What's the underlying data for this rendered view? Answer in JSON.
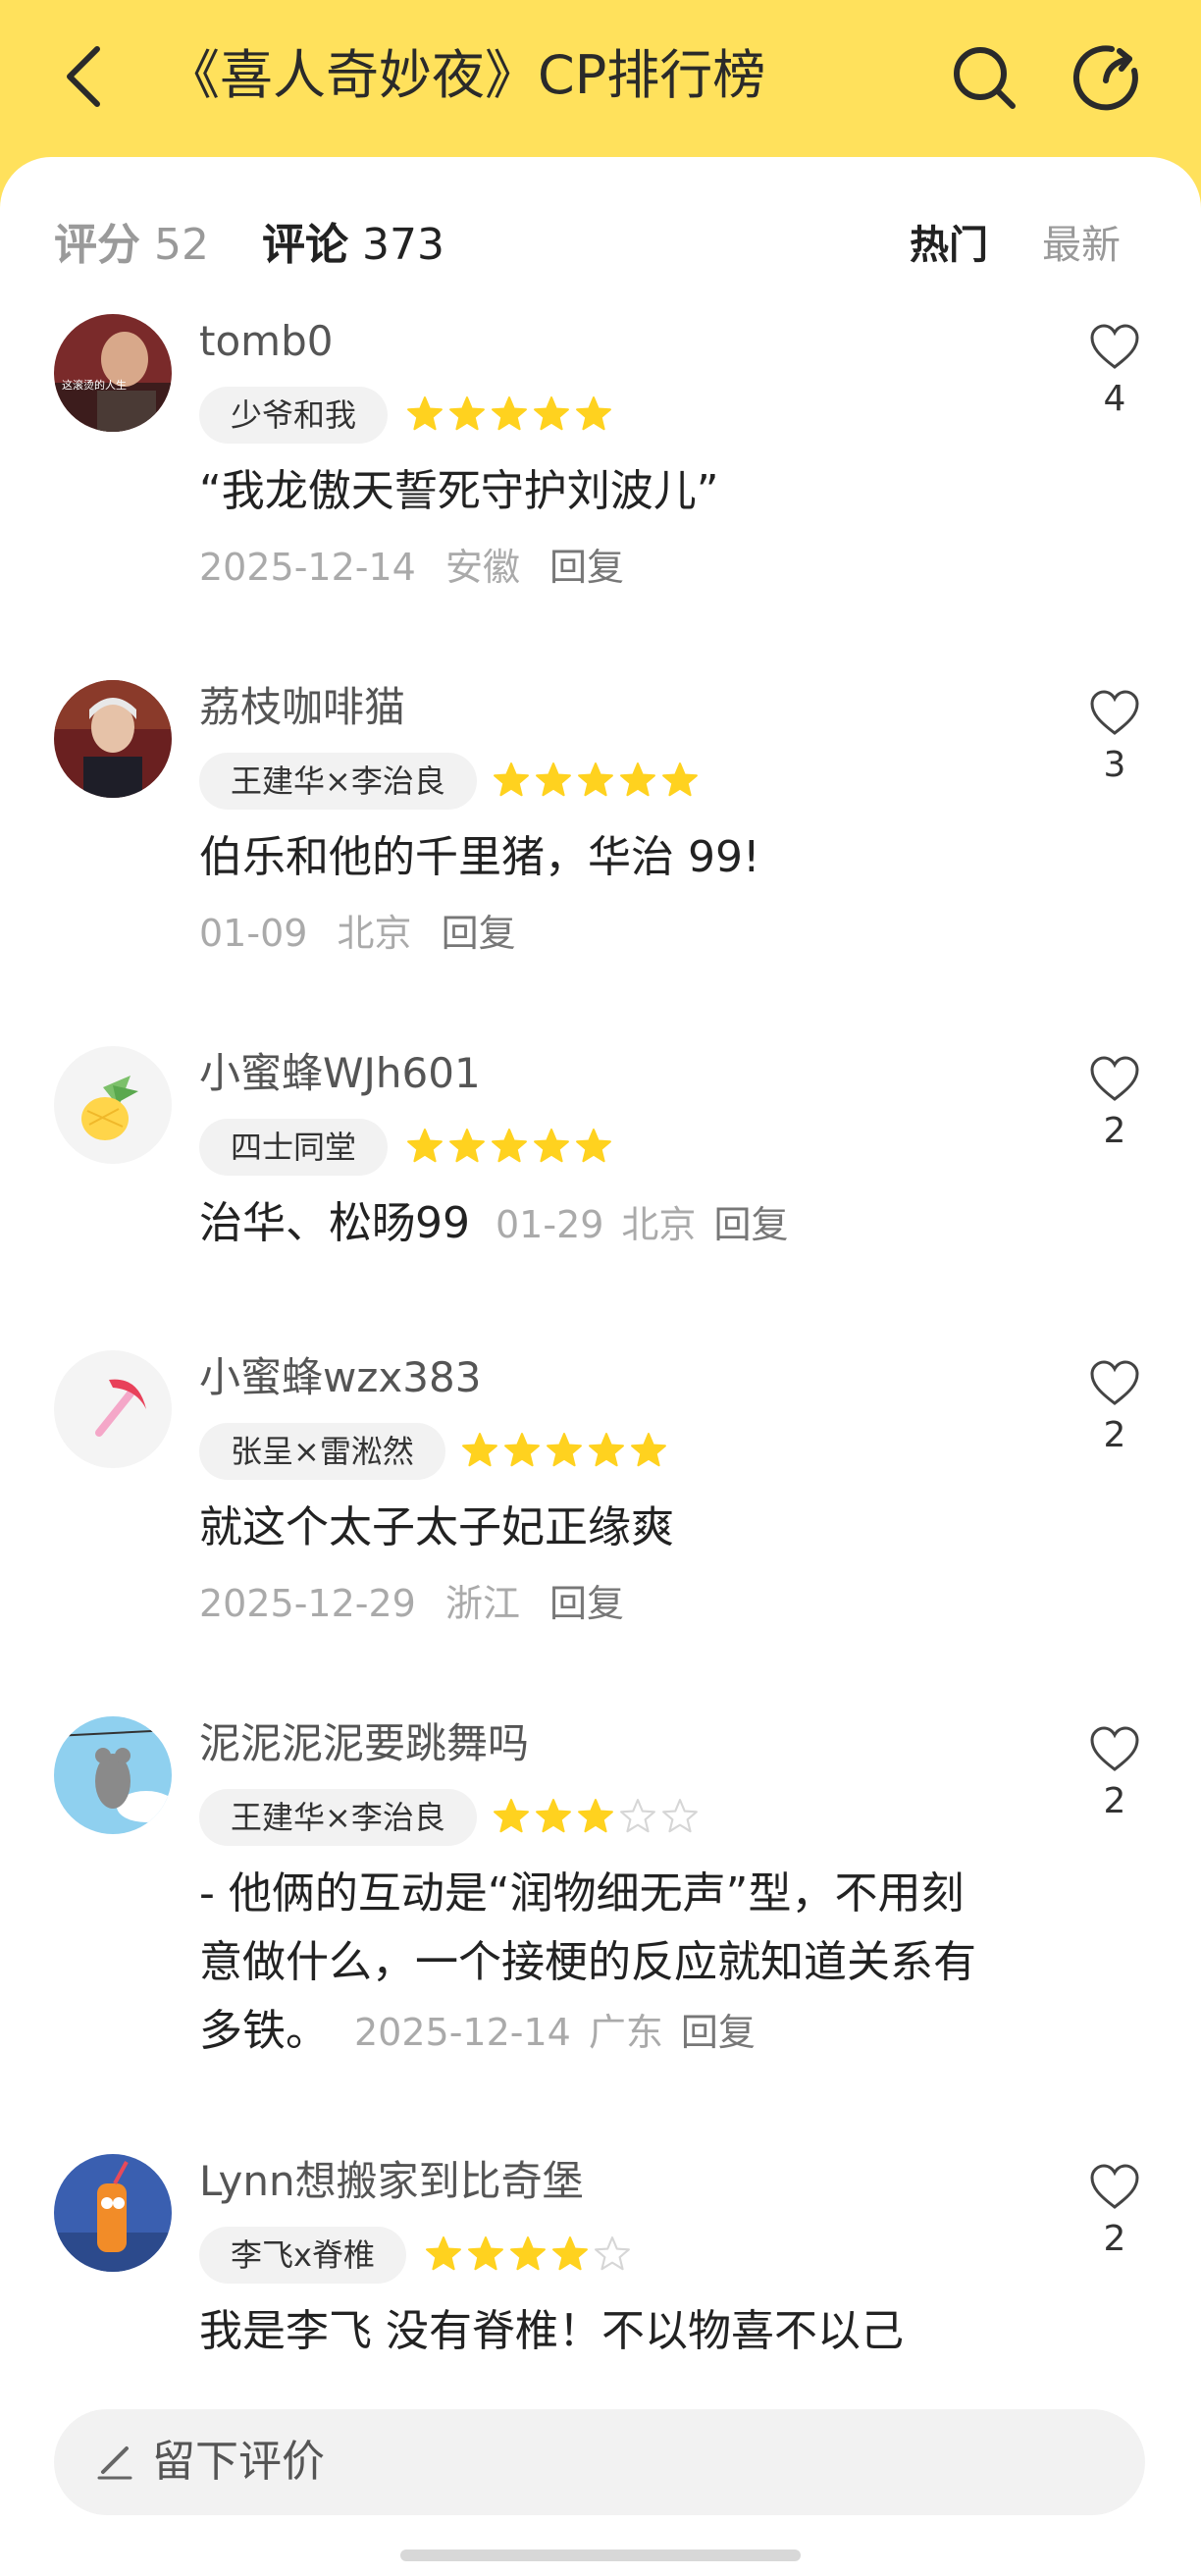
{
  "header": {
    "title": "《喜人奇妙夜》CP排行榜"
  },
  "tabs": {
    "score_label": "评分",
    "score_count": "52",
    "comments_label": "评论",
    "comments_count": "373",
    "sort_hot": "热门",
    "sort_new": "最新"
  },
  "colors": {
    "accent": "#ffe15c",
    "star_on": "#ffd21f",
    "star_off": "#e6e6e6"
  },
  "comments": [
    {
      "username": "tomb0",
      "avatar_text": "这滚烫的人生",
      "tag": "少爷和我",
      "rating": 5,
      "content": "“我龙傲天誓死守护刘波儿”",
      "date": "2025-12-14",
      "location": "安徽",
      "reply": "回复",
      "likes": "4"
    },
    {
      "username": "荔枝咖啡猫",
      "tag": "王建华×李治良",
      "rating": 5,
      "content": "伯乐和他的千里猪，华治 99!",
      "date": "01-09",
      "location": "北京",
      "reply": "回复",
      "likes": "3"
    },
    {
      "username": "小蜜蜂WJh601",
      "tag": "四士同堂",
      "rating": 5,
      "content": "治华、松旸99",
      "date": "01-29",
      "location": "北京",
      "reply": "回复",
      "likes": "2"
    },
    {
      "username": "小蜜蜂wzx383",
      "tag": "张呈×雷淞然",
      "rating": 5,
      "content": "就这个太子太子妃正缘爽",
      "date": "2025-12-29",
      "location": "浙江",
      "reply": "回复",
      "likes": "2"
    },
    {
      "username": "泥泥泥泥要跳舞吗",
      "tag": "王建华×李治良",
      "rating": 3,
      "content_line1": "- 他俩的互动是“润物细无声”型，不用刻",
      "content_line2": "意做什么，一个接梗的反应就知道关系有",
      "content_line3": "多铁。",
      "date": "2025-12-14",
      "location": "广东",
      "reply": "回复",
      "likes": "2"
    },
    {
      "username": "Lynn想搬家到比奇堡",
      "tag": "李飞x脊椎",
      "rating": 4,
      "content": "我是李飞 没有脊椎！不以物喜不以己",
      "likes": "2"
    }
  ],
  "bottom_bar": {
    "placeholder": "留下评价"
  },
  "icons": {
    "back": "chevron-left-icon",
    "search": "search-icon",
    "share": "share-icon",
    "like": "heart-outline-icon",
    "star": "star-icon",
    "pen": "pen-icon"
  }
}
